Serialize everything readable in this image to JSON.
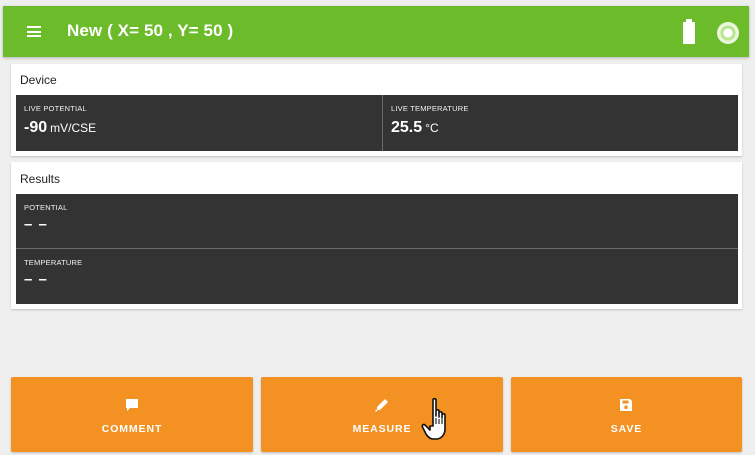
{
  "appbar": {
    "title": "New ( X= 50 , Y= 50 )",
    "menu_icon": "hamburger-menu-icon",
    "battery_icon": "battery-icon",
    "status_icon": "connection-status-icon",
    "color": "#6cbb2b"
  },
  "device": {
    "title": "Device",
    "live_potential": {
      "label": "LIVE POTENTIAL",
      "value": "-90",
      "unit": "mV/CSE"
    },
    "live_temperature": {
      "label": "LIVE TEMPERATURE",
      "value": "25.5",
      "unit": "°C"
    }
  },
  "results": {
    "title": "Results",
    "potential": {
      "label": "POTENTIAL",
      "value": "– –"
    },
    "temperature": {
      "label": "TEMPERATURE",
      "value": "– –"
    }
  },
  "actions": {
    "color": "#f39123",
    "comment": {
      "label": "COMMENT",
      "icon": "comment-icon"
    },
    "measure": {
      "label": "MEASURE",
      "icon": "pen-icon"
    },
    "save": {
      "label": "SAVE",
      "icon": "save-icon"
    }
  }
}
